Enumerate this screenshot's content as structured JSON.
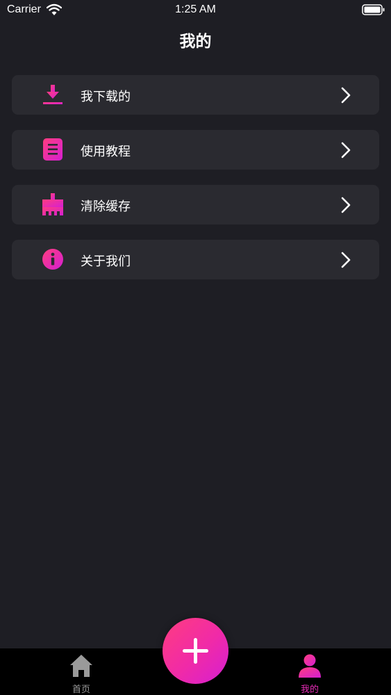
{
  "status_bar": {
    "carrier": "Carrier",
    "time": "1:25 AM",
    "wifi_icon": "wifi-icon",
    "battery_icon": "battery-icon"
  },
  "header": {
    "title": "我的"
  },
  "menu": {
    "items": [
      {
        "label": "我下载的",
        "icon": "download-icon"
      },
      {
        "label": "使用教程",
        "icon": "document-icon"
      },
      {
        "label": "清除缓存",
        "icon": "broom-icon"
      },
      {
        "label": "关于我们",
        "icon": "info-icon"
      }
    ],
    "chevron_icon": "chevron-right-icon"
  },
  "tab_bar": {
    "tabs": [
      {
        "label": "首页",
        "icon": "home-icon",
        "active": false
      },
      {
        "label": "我的",
        "icon": "person-icon",
        "active": true
      }
    ],
    "add_button_icon": "plus-icon"
  },
  "colors": {
    "background": "#1e1e24",
    "card": "#2a2a30",
    "accent_start": "#ff3d7f",
    "accent_end": "#d51fd2",
    "tab_bar": "#000000",
    "inactive_tab": "#9a9a9a"
  }
}
